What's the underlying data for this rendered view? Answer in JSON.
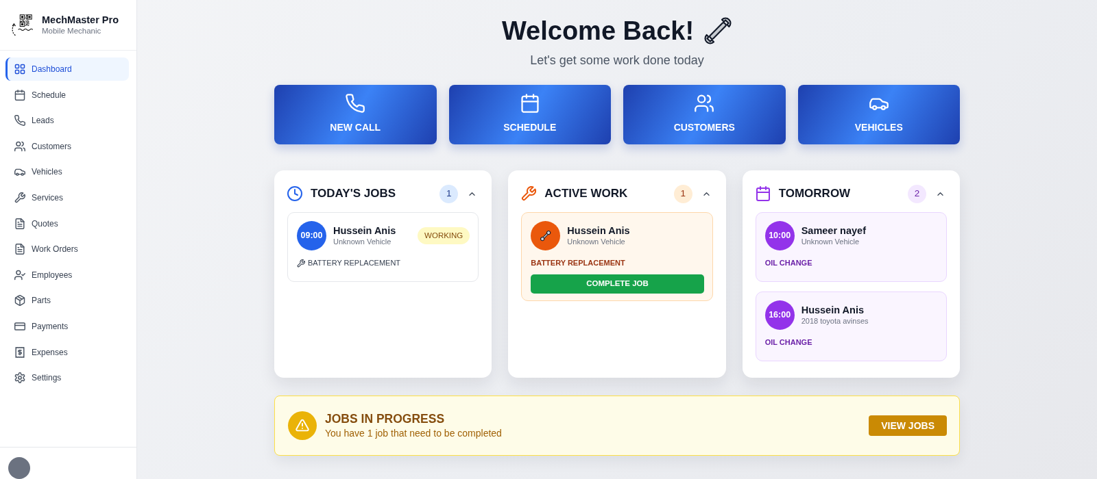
{
  "sidebar": {
    "brand": {
      "title": "MechMaster Pro",
      "subtitle": "Mobile Mechanic"
    },
    "items": [
      {
        "label": "Dashboard",
        "selected": true
      },
      {
        "label": "Schedule",
        "selected": false
      },
      {
        "label": "Leads",
        "selected": false
      },
      {
        "label": "Customers",
        "selected": false
      },
      {
        "label": "Vehicles",
        "selected": false
      },
      {
        "label": "Services",
        "selected": false
      },
      {
        "label": "Quotes",
        "selected": false
      },
      {
        "label": "Work Orders",
        "selected": false
      },
      {
        "label": "Employees",
        "selected": false
      },
      {
        "label": "Parts",
        "selected": false
      },
      {
        "label": "Payments",
        "selected": false
      },
      {
        "label": "Expenses",
        "selected": false
      },
      {
        "label": "Settings",
        "selected": false
      }
    ]
  },
  "header": {
    "title": "Welcome Back!",
    "subtitle": "Let's get some work done today"
  },
  "quick_actions": [
    "NEW CALL",
    "SCHEDULE",
    "CUSTOMERS",
    "VEHICLES"
  ],
  "cards": [
    {
      "kind": "today",
      "title": "TODAY'S JOBS",
      "count": "1",
      "expanded": true,
      "jobs": [
        {
          "time": "09:00",
          "customer": "Hussein Anis",
          "vehicle": "Unknown Vehicle",
          "service": "BATTERY REPLACEMENT",
          "status": "WORKING"
        }
      ]
    },
    {
      "kind": "active",
      "title": "ACTIVE WORK",
      "count": "1",
      "expanded": true,
      "jobs": [
        {
          "customer": "Hussein Anis",
          "vehicle": "Unknown Vehicle",
          "service": "BATTERY REPLACEMENT",
          "action": "COMPLETE JOB"
        }
      ]
    },
    {
      "kind": "tomorrow",
      "title": "TOMORROW",
      "count": "2",
      "expanded": true,
      "jobs": [
        {
          "time": "10:00",
          "customer": "Sameer nayef",
          "vehicle": "Unknown Vehicle",
          "service": "OIL CHANGE"
        },
        {
          "time": "16:00",
          "customer": "Hussein Anis",
          "vehicle": "2018 toyota avinses",
          "service": "OIL CHANGE"
        }
      ]
    }
  ],
  "alert": {
    "title": "JOBS IN PROGRESS",
    "message": "You have 1 job that need to be completed",
    "button": "VIEW JOBS"
  }
}
